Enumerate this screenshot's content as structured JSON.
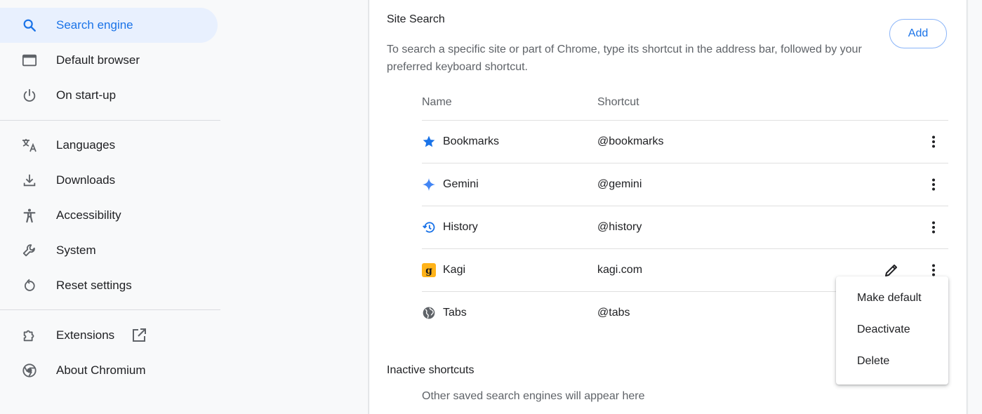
{
  "sidebar": {
    "items": [
      {
        "label": "Search engine",
        "icon": "search-icon"
      },
      {
        "label": "Default browser",
        "icon": "browser-window-icon"
      },
      {
        "label": "On start-up",
        "icon": "power-icon"
      },
      {
        "label": "Languages",
        "icon": "translate-icon"
      },
      {
        "label": "Downloads",
        "icon": "download-icon"
      },
      {
        "label": "Accessibility",
        "icon": "accessibility-icon"
      },
      {
        "label": "System",
        "icon": "wrench-icon"
      },
      {
        "label": "Reset settings",
        "icon": "reset-icon"
      },
      {
        "label": "Extensions",
        "icon": "extension-icon"
      },
      {
        "label": "About Chromium",
        "icon": "chromium-icon"
      }
    ],
    "selected": "Search engine",
    "accent": "#1a73e8"
  },
  "site_search": {
    "title": "Site Search",
    "description": "To search a specific site or part of Chrome, type its shortcut in the address bar, followed by your preferred keyboard shortcut.",
    "add_label": "Add",
    "columns": {
      "name": "Name",
      "shortcut": "Shortcut"
    },
    "rows": [
      {
        "name": "Bookmarks",
        "shortcut": "@bookmarks",
        "icon": "star-icon"
      },
      {
        "name": "Gemini",
        "shortcut": "@gemini",
        "icon": "sparkle-icon"
      },
      {
        "name": "History",
        "shortcut": "@history",
        "icon": "history-icon"
      },
      {
        "name": "Kagi",
        "shortcut": "kagi.com",
        "icon": "kagi-logo-icon"
      },
      {
        "name": "Tabs",
        "shortcut": "@tabs",
        "icon": "globe-icon"
      }
    ]
  },
  "inactive": {
    "title": "Inactive shortcuts",
    "description": "Other saved search engines will appear here"
  },
  "context_menu": {
    "items": [
      "Make default",
      "Deactivate",
      "Delete"
    ]
  }
}
